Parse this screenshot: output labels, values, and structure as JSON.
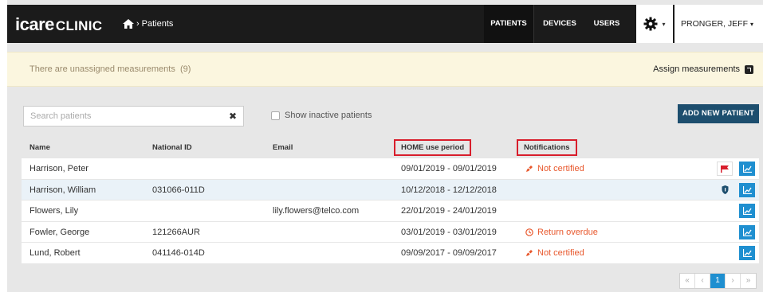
{
  "app": {
    "brand_main": "icare",
    "brand_sub": "CLINIC"
  },
  "breadcrumb": {
    "home_icon": "home-icon",
    "current": "Patients"
  },
  "nav": {
    "tabs": [
      "PATIENTS",
      "DEVICES",
      "USERS"
    ],
    "active_tab": "PATIENTS",
    "settings_icon": "gear-icon",
    "user": "PRONGER, JEFF"
  },
  "alert": {
    "text": "There are unassigned measurements",
    "count": "(9)",
    "link": "Assign measurements",
    "link_icon": "external-link-icon"
  },
  "toolbar": {
    "search_placeholder": "Search patients",
    "clear_icon": "close-icon",
    "inactive_label": "Show inactive patients",
    "inactive_checked": false,
    "add_button": "ADD NEW PATIENT"
  },
  "table": {
    "headers": {
      "name": "Name",
      "national_id": "National ID",
      "email": "Email",
      "home_period": "HOME use period",
      "notifications": "Notifications"
    },
    "rows": [
      {
        "name": "Harrison, Peter",
        "national_id": "",
        "email": "",
        "period": "09/01/2019 - 09/01/2019",
        "notification": "Not certified",
        "notification_icon": "pencil-slash-icon",
        "flag": true,
        "info": false,
        "selected": false
      },
      {
        "name": "Harrison, William",
        "national_id": "031066-011D",
        "email": "",
        "period": "10/12/2018 - 12/12/2018",
        "notification": "",
        "notification_icon": "",
        "flag": false,
        "info": true,
        "selected": true
      },
      {
        "name": "Flowers, Lily",
        "national_id": "",
        "email": "lily.flowers@telco.com",
        "period": "22/01/2019 - 24/01/2019",
        "notification": "",
        "notification_icon": "",
        "flag": false,
        "info": false,
        "selected": false
      },
      {
        "name": "Fowler, George",
        "national_id": "121266AUR",
        "email": "",
        "period": "03/01/2019 - 03/01/2019",
        "notification": "Return overdue",
        "notification_icon": "clock-icon",
        "flag": false,
        "info": false,
        "selected": false
      },
      {
        "name": "Lund, Robert",
        "national_id": "041146-014D",
        "email": "",
        "period": "09/09/2017 - 09/09/2017",
        "notification": "Not certified",
        "notification_icon": "pencil-slash-icon",
        "flag": false,
        "info": false,
        "selected": false
      }
    ],
    "row_action_icon": "chart-icon"
  },
  "pagination": {
    "first": "«",
    "prev": "‹",
    "current": "1",
    "next": "›",
    "last": "»"
  },
  "colors": {
    "navbar": "#1b1b1b",
    "alert_bg": "#fbf6df",
    "primary_button": "#1d4e6e",
    "action_blue": "#1f8fd0",
    "warning": "#e8582d",
    "highlight_box": "#d81e2c"
  }
}
